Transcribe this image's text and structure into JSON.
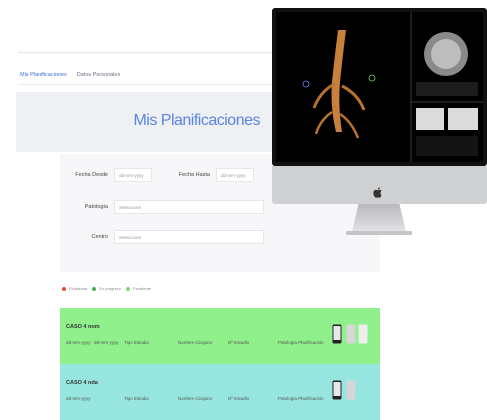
{
  "tabs": [
    "Mis Planificaciones",
    "Datos Personales"
  ],
  "page_title": "Mis Planificaciones",
  "filters": {
    "fecha_desde_label": "Fecha Desde",
    "fecha_desde_value": "dd-mm-yyyy",
    "fecha_hasta_label": "Fecha Hasta",
    "fecha_hasta_value": "dd-mm-yyyy",
    "patologia_label": "Patología",
    "patologia_value": "Seleccione",
    "centro_label": "Centro",
    "centro_value": "Seleccione"
  },
  "legend": [
    {
      "label": "Finalizada",
      "color": "#e14b3b"
    },
    {
      "label": "En progreso",
      "color": "#4caf50"
    },
    {
      "label": "Pendiente",
      "color": "#8bd46d"
    }
  ],
  "cards": [
    {
      "name": "CASO 4 nom",
      "color": "#8ff08c",
      "cells": [
        "dd-mm-yyyy",
        "dd-mm-yyyy",
        "Tipo Estudio",
        "Nombre Cirujano",
        "Nº Estudio",
        "Patología Planificación"
      ]
    },
    {
      "name": "CASO 4 nda",
      "color": "#96e6df",
      "cells": [
        "dd-mm-yyyy",
        "Tipo Estudio",
        "Nombre Cirujano",
        "Nº Estudio",
        "Patología Planificación"
      ]
    }
  ],
  "colors": {
    "accent_blue": "#5a86e0",
    "panel_bg": "#f7f7f9",
    "imac_bezel": "#111111",
    "imac_chin": "#cfd0d2"
  },
  "icons": [
    "apple-logo-icon",
    "ct-scan-thumbnail",
    "phone-device-icon"
  ]
}
